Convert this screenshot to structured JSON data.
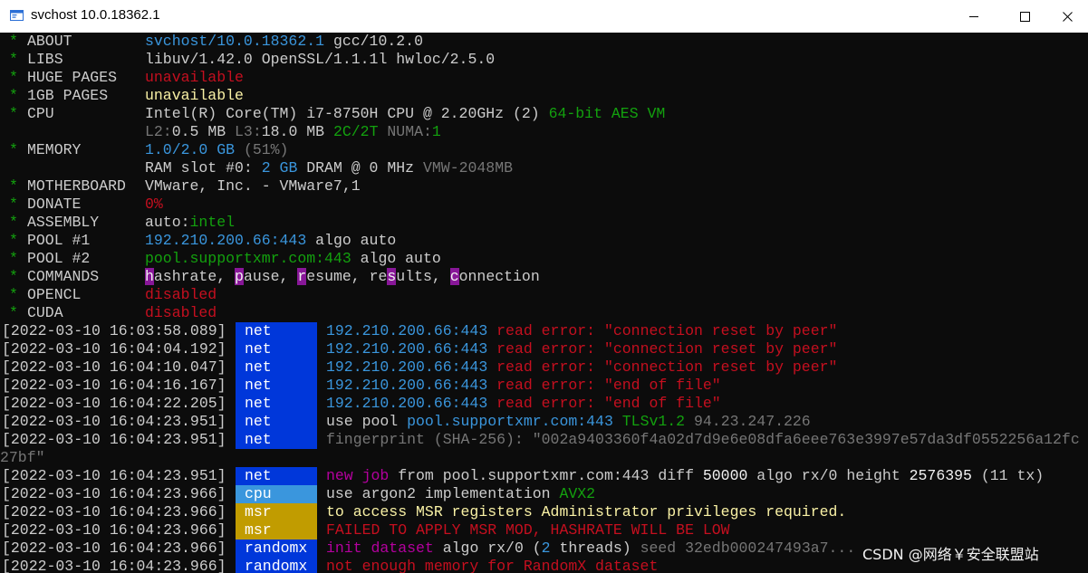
{
  "window": {
    "title": "svchost 10.0.18362.1"
  },
  "summary": [
    {
      "label": "ABOUT",
      "parts": [
        {
          "t": "svchost/10.0.18362.1",
          "c": "c-cyan"
        },
        {
          "t": " gcc/10.2.0",
          "c": "c-white"
        }
      ]
    },
    {
      "label": "LIBS",
      "parts": [
        {
          "t": "libuv/1.42.0 OpenSSL/1.1.1l hwloc/2.5.0",
          "c": "c-white"
        }
      ]
    },
    {
      "label": "HUGE PAGES",
      "parts": [
        {
          "t": "unavailable",
          "c": "c-red"
        }
      ]
    },
    {
      "label": "1GB PAGES",
      "parts": [
        {
          "t": "unavailable",
          "c": "c-yellow"
        }
      ]
    },
    {
      "label": "CPU",
      "parts": [
        {
          "t": "Intel(R) Core(TM) i7-8750H CPU @ 2.20GHz (2) ",
          "c": "c-white"
        },
        {
          "t": "64-bit AES VM",
          "c": "c-green"
        }
      ]
    },
    {
      "label": "",
      "parts": [
        {
          "t": "L2:",
          "c": "c-gray"
        },
        {
          "t": "0.5 MB ",
          "c": "c-white"
        },
        {
          "t": "L3:",
          "c": "c-gray"
        },
        {
          "t": "18.0 MB ",
          "c": "c-white"
        },
        {
          "t": "2C/2T ",
          "c": "c-green"
        },
        {
          "t": "NUMA:",
          "c": "c-gray"
        },
        {
          "t": "1",
          "c": "c-green"
        }
      ]
    },
    {
      "label": "MEMORY",
      "parts": [
        {
          "t": "1.0/2.0 ",
          "c": "c-cyan"
        },
        {
          "t": "GB ",
          "c": "c-cyan"
        },
        {
          "t": "(51%)",
          "c": "c-gray"
        }
      ]
    },
    {
      "label": "",
      "parts": [
        {
          "t": "RAM slot #0: ",
          "c": "c-white"
        },
        {
          "t": "2 GB ",
          "c": "c-cyan"
        },
        {
          "t": "DRAM @ 0 MHz ",
          "c": "c-white"
        },
        {
          "t": "VMW-2048MB",
          "c": "c-gray"
        }
      ]
    },
    {
      "label": "MOTHERBOARD",
      "parts": [
        {
          "t": "VMware, Inc. - VMware7,1",
          "c": "c-white"
        }
      ]
    },
    {
      "label": "DONATE",
      "parts": [
        {
          "t": "0%",
          "c": "c-red"
        }
      ]
    },
    {
      "label": "ASSEMBLY",
      "parts": [
        {
          "t": "auto:",
          "c": "c-white"
        },
        {
          "t": "intel",
          "c": "c-green"
        }
      ]
    },
    {
      "label": "POOL #1",
      "parts": [
        {
          "t": "192.210.200.66:443",
          "c": "c-cyan"
        },
        {
          "t": " algo auto",
          "c": "c-white"
        }
      ]
    },
    {
      "label": "POOL #2",
      "parts": [
        {
          "t": "pool.supportxmr.com:443",
          "c": "c-green"
        },
        {
          "t": " algo auto",
          "c": "c-white"
        }
      ]
    },
    {
      "label": "COMMANDS",
      "parts": [
        {
          "t": "h",
          "c": "hl"
        },
        {
          "t": "ashrate, ",
          "c": "c-white"
        },
        {
          "t": "p",
          "c": "hl"
        },
        {
          "t": "ause, ",
          "c": "c-white"
        },
        {
          "t": "r",
          "c": "hl"
        },
        {
          "t": "esume, re",
          "c": "c-white"
        },
        {
          "t": "s",
          "c": "hl"
        },
        {
          "t": "ults, ",
          "c": "c-white"
        },
        {
          "t": "c",
          "c": "hl"
        },
        {
          "t": "onnection",
          "c": "c-white"
        }
      ]
    },
    {
      "label": "OPENCL",
      "parts": [
        {
          "t": "disabled",
          "c": "c-red"
        }
      ]
    },
    {
      "label": "CUDA",
      "parts": [
        {
          "t": "disabled",
          "c": "c-red"
        }
      ]
    }
  ],
  "log": [
    {
      "ts": "[2022-03-10 16:03:58.089]",
      "tag": "net",
      "tag_bg": "bg-net",
      "parts": [
        {
          "t": "192.210.200.66:443 ",
          "c": "c-cyan"
        },
        {
          "t": "read error: \"connection reset by peer\"",
          "c": "c-red"
        }
      ]
    },
    {
      "ts": "[2022-03-10 16:04:04.192]",
      "tag": "net",
      "tag_bg": "bg-net",
      "parts": [
        {
          "t": "192.210.200.66:443 ",
          "c": "c-cyan"
        },
        {
          "t": "read error: \"connection reset by peer\"",
          "c": "c-red"
        }
      ]
    },
    {
      "ts": "[2022-03-10 16:04:10.047]",
      "tag": "net",
      "tag_bg": "bg-net",
      "parts": [
        {
          "t": "192.210.200.66:443 ",
          "c": "c-cyan"
        },
        {
          "t": "read error: \"connection reset by peer\"",
          "c": "c-red"
        }
      ]
    },
    {
      "ts": "[2022-03-10 16:04:16.167]",
      "tag": "net",
      "tag_bg": "bg-net",
      "parts": [
        {
          "t": "192.210.200.66:443 ",
          "c": "c-cyan"
        },
        {
          "t": "read error: \"end of file\"",
          "c": "c-red"
        }
      ]
    },
    {
      "ts": "[2022-03-10 16:04:22.205]",
      "tag": "net",
      "tag_bg": "bg-net",
      "parts": [
        {
          "t": "192.210.200.66:443 ",
          "c": "c-cyan"
        },
        {
          "t": "read error: \"end of file\"",
          "c": "c-red"
        }
      ]
    },
    {
      "ts": "[2022-03-10 16:04:23.951]",
      "tag": "net",
      "tag_bg": "bg-net",
      "parts": [
        {
          "t": "use pool ",
          "c": "c-white"
        },
        {
          "t": "pool.supportxmr.com:443 ",
          "c": "c-cyan"
        },
        {
          "t": "TLSv1.2 ",
          "c": "c-green"
        },
        {
          "t": "94.23.247.226",
          "c": "c-gray"
        }
      ]
    },
    {
      "ts": "[2022-03-10 16:04:23.951]",
      "tag": "net",
      "tag_bg": "bg-net",
      "parts": [
        {
          "t": "fingerprint (SHA-256): \"002a9403360f4a02d7d9e6e08dfa6eee763e3997e57da3df0552256a12fc",
          "c": "c-gray"
        }
      ]
    },
    {
      "ts": "",
      "tag": "",
      "tag_bg": "",
      "wrap": [
        {
          "t": "27bf\"",
          "c": "c-gray"
        }
      ]
    },
    {
      "ts": "[2022-03-10 16:04:23.951]",
      "tag": "net",
      "tag_bg": "bg-net",
      "parts": [
        {
          "t": "new job ",
          "c": "c-magenta"
        },
        {
          "t": "from pool.supportxmr.com:443 diff ",
          "c": "c-white"
        },
        {
          "t": "50000 ",
          "c": "c-bwhite"
        },
        {
          "t": "algo rx/0 height ",
          "c": "c-white"
        },
        {
          "t": "2576395 ",
          "c": "c-bwhite"
        },
        {
          "t": "(11 tx)",
          "c": "c-white"
        }
      ]
    },
    {
      "ts": "[2022-03-10 16:04:23.966]",
      "tag": "cpu",
      "tag_bg": "bg-cpu",
      "parts": [
        {
          "t": "use argon2 implementation ",
          "c": "c-white"
        },
        {
          "t": "AVX2",
          "c": "c-green"
        }
      ]
    },
    {
      "ts": "[2022-03-10 16:04:23.966]",
      "tag": "msr",
      "tag_bg": "bg-msr",
      "parts": [
        {
          "t": "to access MSR registers Administrator privileges required.",
          "c": "c-yellow"
        }
      ]
    },
    {
      "ts": "[2022-03-10 16:04:23.966]",
      "tag": "msr",
      "tag_bg": "bg-msr",
      "parts": [
        {
          "t": "FAILED TO APPLY MSR MOD, HASHRATE WILL BE LOW",
          "c": "c-red"
        }
      ]
    },
    {
      "ts": "[2022-03-10 16:04:23.966]",
      "tag": "randomx",
      "tag_bg": "bg-randomx",
      "parts": [
        {
          "t": "init dataset ",
          "c": "c-magenta"
        },
        {
          "t": "algo rx/0 (",
          "c": "c-white"
        },
        {
          "t": "2",
          "c": "c-cyan"
        },
        {
          "t": " threads) ",
          "c": "c-white"
        },
        {
          "t": "seed 32edb000247493a7...",
          "c": "c-gray"
        }
      ]
    },
    {
      "ts": "[2022-03-10 16:04:23.966]",
      "tag": "randomx",
      "tag_bg": "bg-randomx",
      "parts": [
        {
          "t": "not enough memory for RandomX dataset",
          "c": "c-red"
        }
      ]
    }
  ],
  "watermark": {
    "text": "CSDN @网络￥安全联盟站"
  },
  "icons": {
    "app": "console-app-icon",
    "minimize": "minimize-icon",
    "maximize": "maximize-icon",
    "close": "close-icon"
  }
}
